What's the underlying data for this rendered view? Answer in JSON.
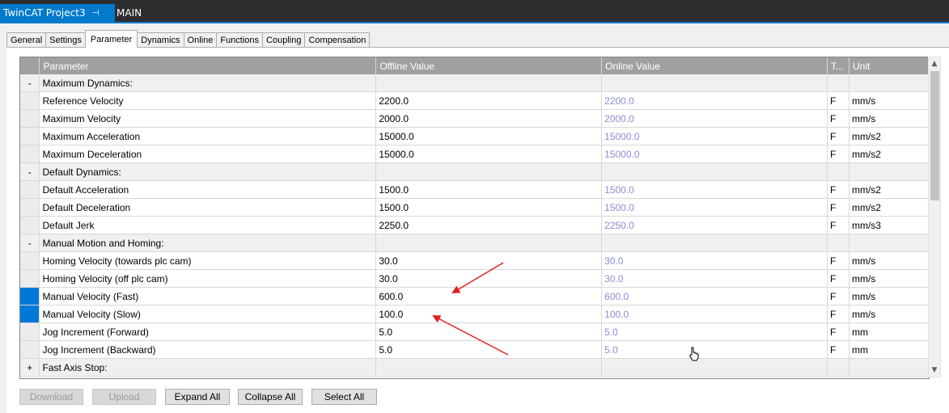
{
  "doc_tabs": {
    "active_title": "TwinCAT Project3",
    "pin_icon": "pin-icon",
    "close_icon": "close-icon",
    "main_title": "MAIN",
    "accent": "#007acc"
  },
  "sub_tabs": [
    "General",
    "Settings",
    "Parameter",
    "Dynamics",
    "Online",
    "Functions",
    "Coupling",
    "Compensation"
  ],
  "active_sub_tab": "Parameter",
  "grid": {
    "columns": {
      "parameter": "Parameter",
      "offline": "Offline Value",
      "online": "Online Value",
      "type": "T...",
      "unit": "Unit"
    },
    "rows": [
      {
        "exp": "-",
        "parameter": "Maximum Dynamics:",
        "offline": "",
        "online": "",
        "type": "",
        "unit": "",
        "group": true
      },
      {
        "exp": "",
        "parameter": "Reference Velocity",
        "offline": "2200.0",
        "online": "2200.0",
        "type": "F",
        "unit": "mm/s"
      },
      {
        "exp": "",
        "parameter": "Maximum Velocity",
        "offline": "2000.0",
        "online": "2000.0",
        "type": "F",
        "unit": "mm/s"
      },
      {
        "exp": "",
        "parameter": "Maximum Acceleration",
        "offline": "15000.0",
        "online": "15000.0",
        "type": "F",
        "unit": "mm/s2"
      },
      {
        "exp": "",
        "parameter": "Maximum Deceleration",
        "offline": "15000.0",
        "online": "15000.0",
        "type": "F",
        "unit": "mm/s2"
      },
      {
        "exp": "-",
        "parameter": "Default Dynamics:",
        "offline": "",
        "online": "",
        "type": "",
        "unit": "",
        "group": true
      },
      {
        "exp": "",
        "parameter": "Default Acceleration",
        "offline": "1500.0",
        "online": "1500.0",
        "type": "F",
        "unit": "mm/s2"
      },
      {
        "exp": "",
        "parameter": "Default Deceleration",
        "offline": "1500.0",
        "online": "1500.0",
        "type": "F",
        "unit": "mm/s2"
      },
      {
        "exp": "",
        "parameter": "Default Jerk",
        "offline": "2250.0",
        "online": "2250.0",
        "type": "F",
        "unit": "mm/s3"
      },
      {
        "exp": "-",
        "parameter": "Manual Motion and Homing:",
        "offline": "",
        "online": "",
        "type": "",
        "unit": "",
        "group": true
      },
      {
        "exp": "",
        "parameter": "Homing Velocity (towards plc cam)",
        "offline": "30.0",
        "online": "30.0",
        "type": "F",
        "unit": "mm/s"
      },
      {
        "exp": "",
        "parameter": "Homing Velocity (off plc cam)",
        "offline": "30.0",
        "online": "30.0",
        "type": "F",
        "unit": "mm/s"
      },
      {
        "exp": "",
        "parameter": "Manual Velocity (Fast)",
        "offline": "600.0",
        "online": "600.0",
        "type": "F",
        "unit": "mm/s",
        "selected": true
      },
      {
        "exp": "",
        "parameter": "Manual Velocity (Slow)",
        "offline": "100.0",
        "online": "100.0",
        "type": "F",
        "unit": "mm/s",
        "selected": true
      },
      {
        "exp": "",
        "parameter": "Jog Increment (Forward)",
        "offline": "5.0",
        "online": "5.0",
        "type": "F",
        "unit": "mm"
      },
      {
        "exp": "",
        "parameter": "Jog Increment (Backward)",
        "offline": "5.0",
        "online": "5.0",
        "type": "F",
        "unit": "mm"
      },
      {
        "exp": "+",
        "parameter": "Fast Axis Stop:",
        "offline": "",
        "online": "",
        "type": "",
        "unit": "",
        "group": true
      }
    ]
  },
  "buttons": {
    "download": "Download",
    "upload": "Upload",
    "expand_all": "Expand All",
    "collapse_all": "Collapse All",
    "select_all": "Select All"
  },
  "scrollbar": {
    "up_icon": "chevron-up-icon",
    "down_icon": "chevron-down-icon"
  },
  "annotation_color": "#e02020"
}
